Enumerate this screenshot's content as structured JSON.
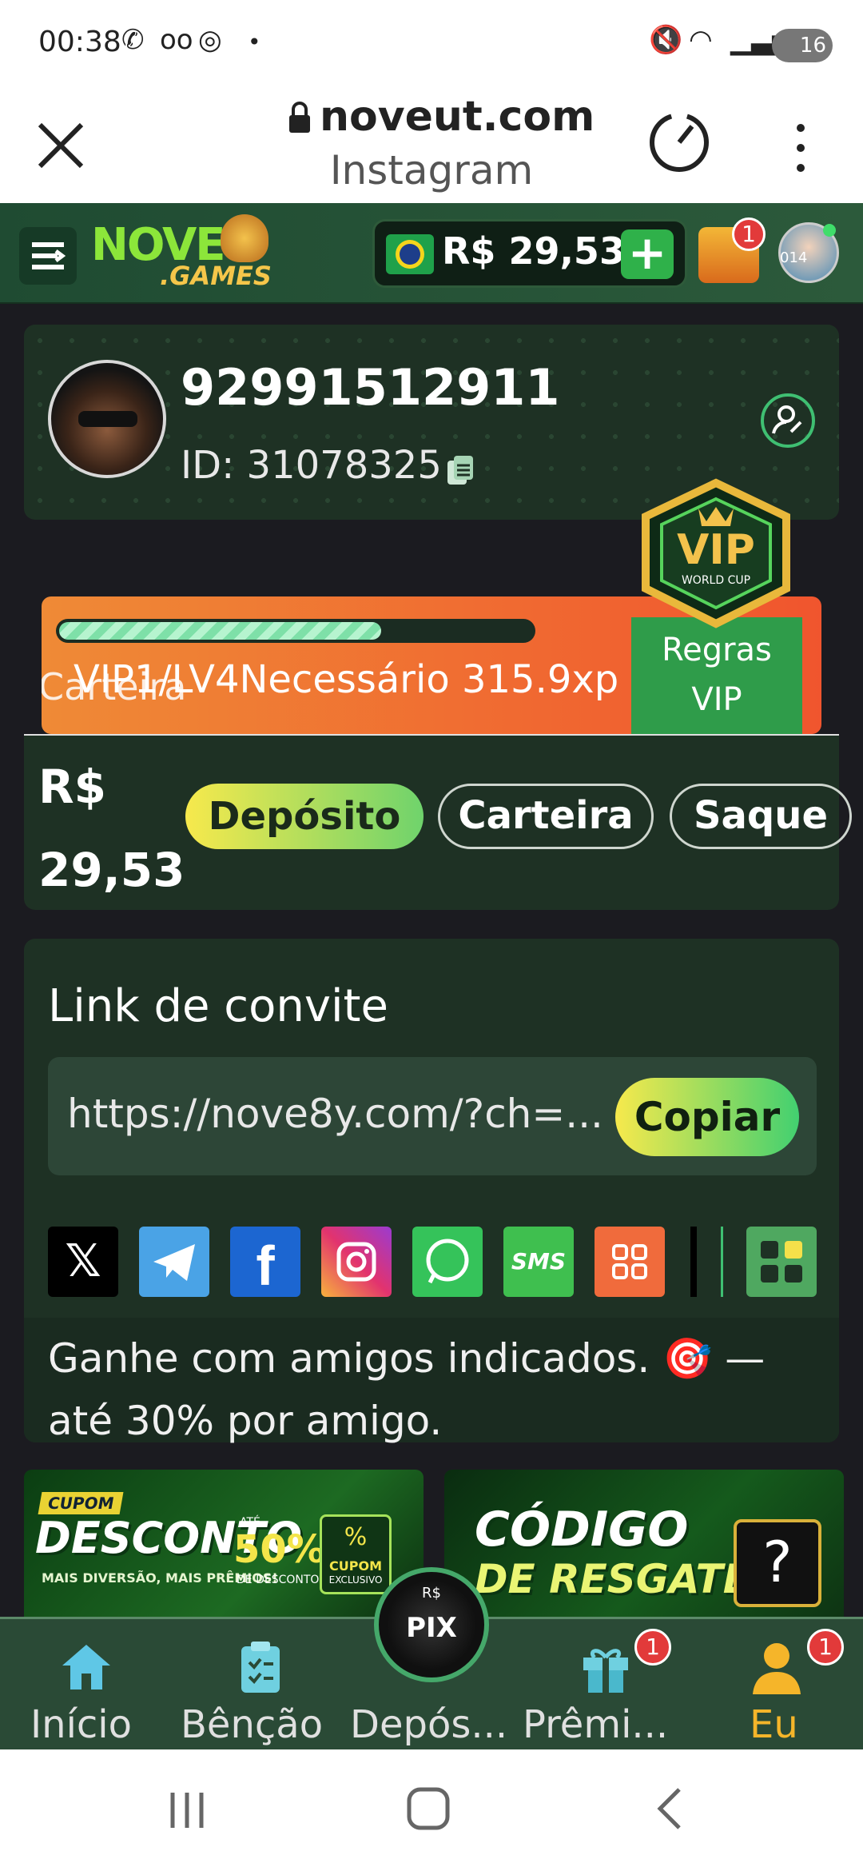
{
  "status_bar": {
    "time": "00:38",
    "battery": "16",
    "dot": "•"
  },
  "browser": {
    "domain": "noveut.com",
    "subtitle": "Instagram"
  },
  "header": {
    "logo_main": "NOVE",
    "logo_sub": ".GAMES",
    "balance": "R$ 29,53",
    "add": "+",
    "chest_badge": "1",
    "avatar_text": "014"
  },
  "profile": {
    "username": "92991512911",
    "user_id": "ID: 31078325"
  },
  "vip": {
    "badge_title": "VIP",
    "badge_sub": "WORLD CUP",
    "progress_fraction": 0.68,
    "progress_text": "VIP1/LV4Necessário 315.9xp l",
    "overlay_text": "Carteira",
    "rules_line1": "Regras",
    "rules_line2": "VIP"
  },
  "wallet": {
    "currency": "R$",
    "amount": "29,53",
    "deposit": "Depósito",
    "wallet": "Carteira",
    "withdraw": "Saque"
  },
  "invite": {
    "title": "Link de convite",
    "link": "https://nove8y.com/?ch=...",
    "copy": "Copiar",
    "earn_text": "Ganhe com amigos indicados. 🎯 — até 30% por amigo.",
    "share_sms": "SMS",
    "share_x": "𝕏",
    "share_f": "f"
  },
  "promos": {
    "left_tag": "CUPOM",
    "left_title": "DESCONTO",
    "left_sub": "MAIS DIVERSÃO, MAIS PRÊMIOS!",
    "left_percent": "50%",
    "left_until": "ATÉ",
    "left_percent_sub": "DE DESCONTO",
    "left_cupom": "CUPOM",
    "left_cupom_sub": "EXCLUSIVO",
    "right_title1": "CÓDIGO",
    "right_title2": "DE RESGATE"
  },
  "bottom_nav": {
    "home": "Início",
    "blessing": "Bênção",
    "deposit": "Depós...",
    "prizes": "Prêmi...",
    "me": "Eu",
    "prizes_badge": "1",
    "me_badge": "1",
    "pix": "PIX",
    "pix_rs": "R$"
  },
  "colors": {
    "accent_green": "#2fb14a",
    "card_bg": "#1e3124",
    "active_nav": "#f5b52a"
  }
}
